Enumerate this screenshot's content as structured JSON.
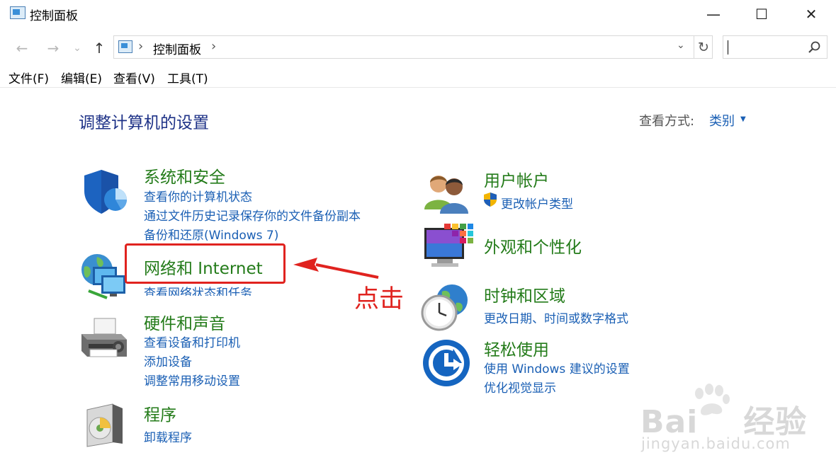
{
  "window": {
    "title": "控制面板",
    "minimize_glyph": "—",
    "maximize_glyph": "☐",
    "close_glyph": "✕"
  },
  "nav": {
    "back_glyph": "←",
    "forward_glyph": "→",
    "recent_glyph": "⌄",
    "up_glyph": "↑"
  },
  "address": {
    "separator": "›",
    "crumb": "控制面板",
    "dropdown_glyph": "⌄",
    "refresh_glyph": "↻"
  },
  "search": {
    "placeholder": ""
  },
  "menu": [
    "文件(F)",
    "编辑(E)",
    "查看(V)",
    "工具(T)"
  ],
  "page": {
    "title": "调整计算机的设置",
    "view_by_label": "查看方式:",
    "view_by_value": "类别",
    "view_by_arrow": "▼"
  },
  "categories": [
    {
      "title": "系统和安全",
      "icon": "shield-icon",
      "links": [
        "查看你的计算机状态",
        "通过文件历史记录保存你的文件备份副本",
        "备份和还原(Windows 7)"
      ]
    },
    {
      "title": "网络和 Internet",
      "icon": "network-icon",
      "links": [
        "查看网络状态和任务"
      ]
    },
    {
      "title": "硬件和声音",
      "icon": "printer-icon",
      "links": [
        "查看设备和打印机",
        "添加设备",
        "调整常用移动设置"
      ]
    },
    {
      "title": "程序",
      "icon": "programs-icon",
      "links": [
        "卸载程序"
      ]
    },
    {
      "title": "用户帐户",
      "icon": "users-icon",
      "links": [
        "更改帐户类型"
      ]
    },
    {
      "title": "外观和个性化",
      "icon": "appearance-icon",
      "links": []
    },
    {
      "title": "时钟和区域",
      "icon": "clock-globe-icon",
      "links": [
        "更改日期、时间或数字格式"
      ]
    },
    {
      "title": "轻松使用",
      "icon": "ease-of-access-icon",
      "links": [
        "使用 Windows 建议的设置",
        "优化视觉显示"
      ]
    }
  ],
  "annotation": {
    "text": "点击",
    "color": "#e0231f"
  },
  "watermark": {
    "brand": "Bai",
    "brand_cn": "经验",
    "url": "jingyan.baidu.com"
  },
  "colors": {
    "title_blue": "#1e3287",
    "link_blue": "#1a5fb4",
    "category_green": "#237b19",
    "annotation_red": "#e0231f"
  }
}
